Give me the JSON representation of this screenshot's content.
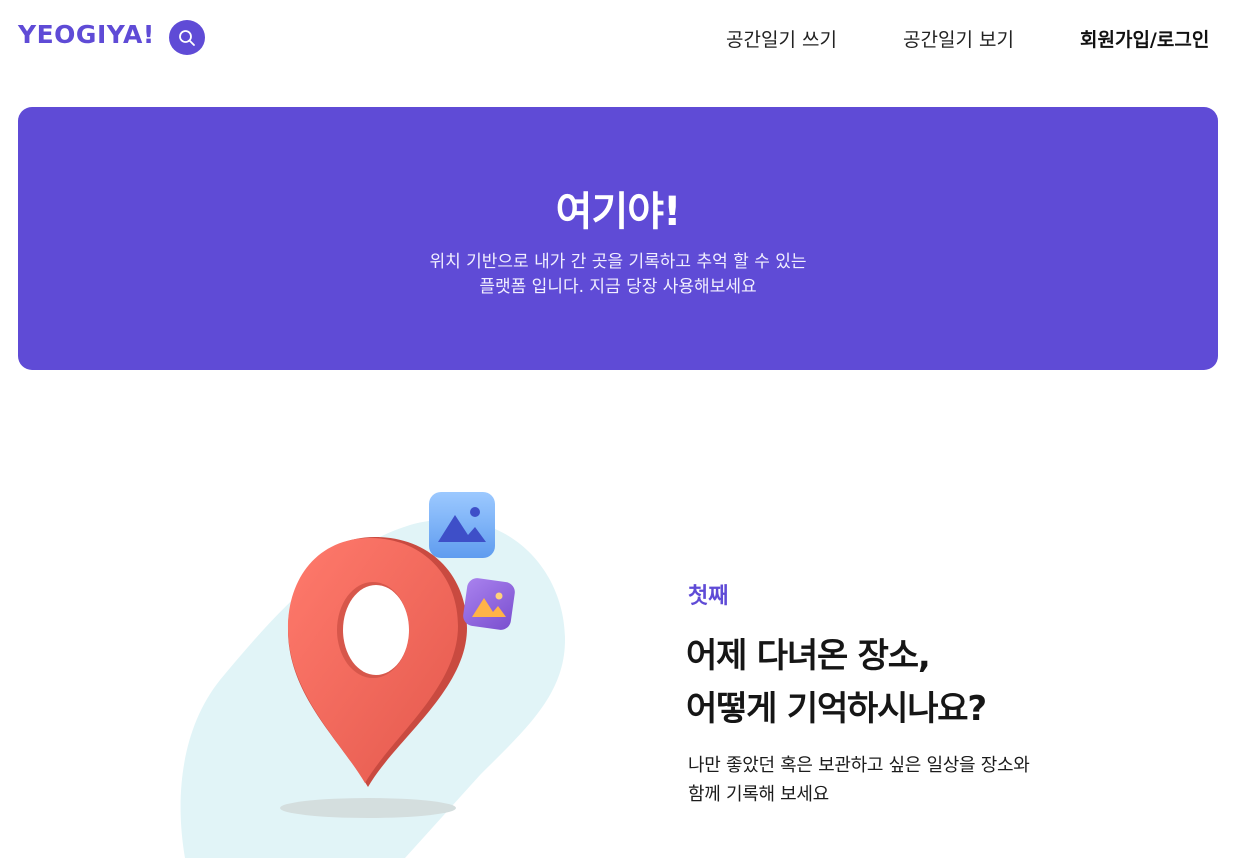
{
  "header": {
    "logo": "YEOGIYA!",
    "search_icon": "search-icon",
    "nav": {
      "write": "공간일기 쓰기",
      "view": "공간일기 보기",
      "auth": "회원가입/로그인"
    }
  },
  "hero": {
    "title": "여기야!",
    "description_line1": "위치 기반으로 내가 간 곳을 기록하고 추억 할 수 있는",
    "description_line2": "플랫폼 입니다. 지금 당장 사용해보세요"
  },
  "feature": {
    "eyebrow": "첫째",
    "heading_line1": "어제 다녀온 장소,",
    "heading_line2": "어떻게 기억하시나요?",
    "description_line1": "나만 좋았던 혹은 보관하고 싶은  일상을 장소와",
    "description_line2": "함께 기록해 보세요",
    "illustration_icons": [
      "location-pin-icon",
      "image-icon",
      "image-icon"
    ]
  },
  "colors": {
    "brand": "#5f4bd6",
    "pin": "#f0675a",
    "blob": "#e1f4f7",
    "image_badge_blue": "#6aa8f0",
    "image_badge_purple": "#8a5cd6"
  }
}
